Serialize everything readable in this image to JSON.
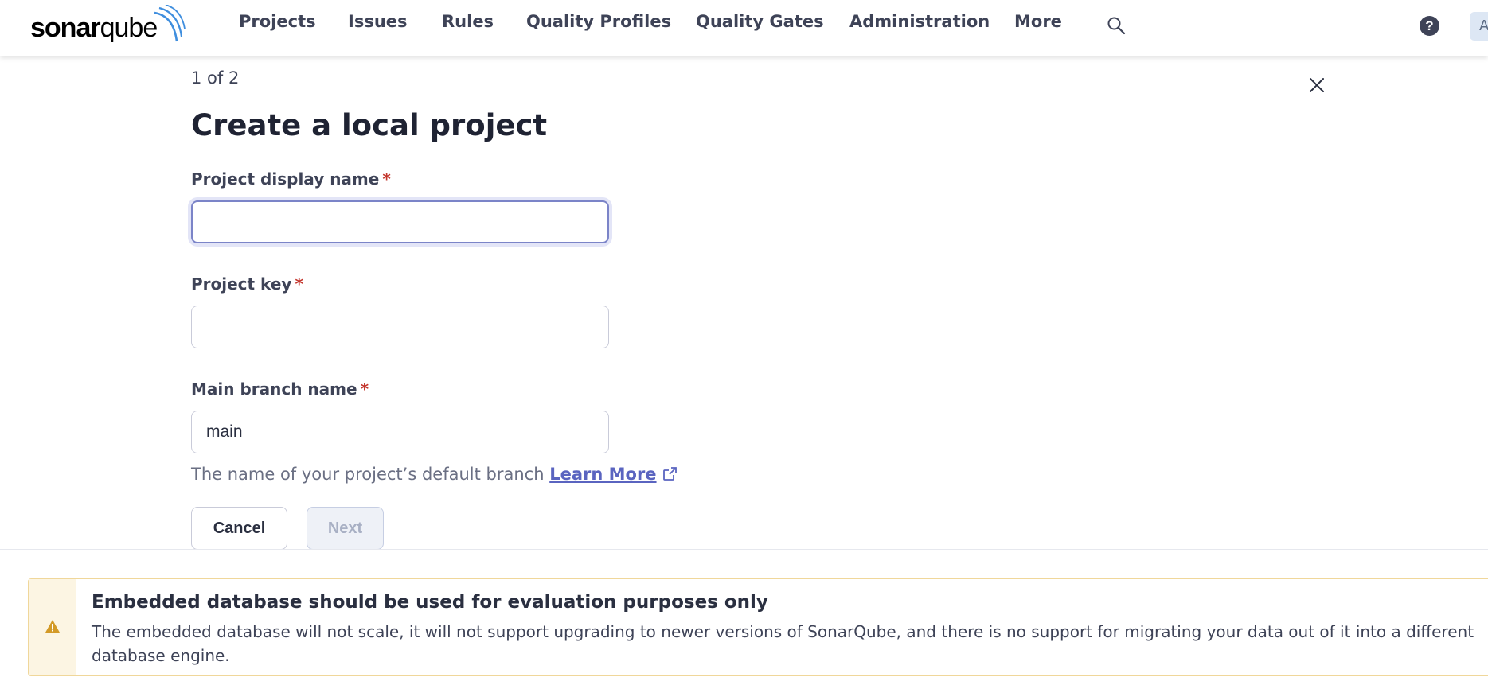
{
  "brand": {
    "logo_prefix": "sonar",
    "logo_suffix": "qube"
  },
  "nav": {
    "items": [
      "Projects",
      "Issues",
      "Rules",
      "Quality Profiles",
      "Quality Gates",
      "Administration",
      "More"
    ],
    "search_icon": "search-icon",
    "help_label": "?",
    "avatar_initial": "A"
  },
  "form": {
    "step": "1 of 2",
    "title": "Create a local project",
    "required_mark": "*",
    "project_name": {
      "label": "Project display name",
      "value": ""
    },
    "project_key": {
      "label": "Project key",
      "value": ""
    },
    "main_branch": {
      "label": "Main branch name",
      "value": "main",
      "helper": "The name of your project’s default branch",
      "learn_more": "Learn More"
    },
    "cancel_label": "Cancel",
    "next_label": "Next"
  },
  "banner": {
    "title": "Embedded database should be used for evaluation purposes only",
    "body": "The embedded database will not scale, it will not support upgrading to newer versions of SonarQube, and there is no support for migrating your data out of it into a different database engine."
  },
  "colors": {
    "accent": "#5a64c0",
    "required": "#c3352c",
    "warning": "#d39a27",
    "warning_bg": "#fcf5e3"
  }
}
